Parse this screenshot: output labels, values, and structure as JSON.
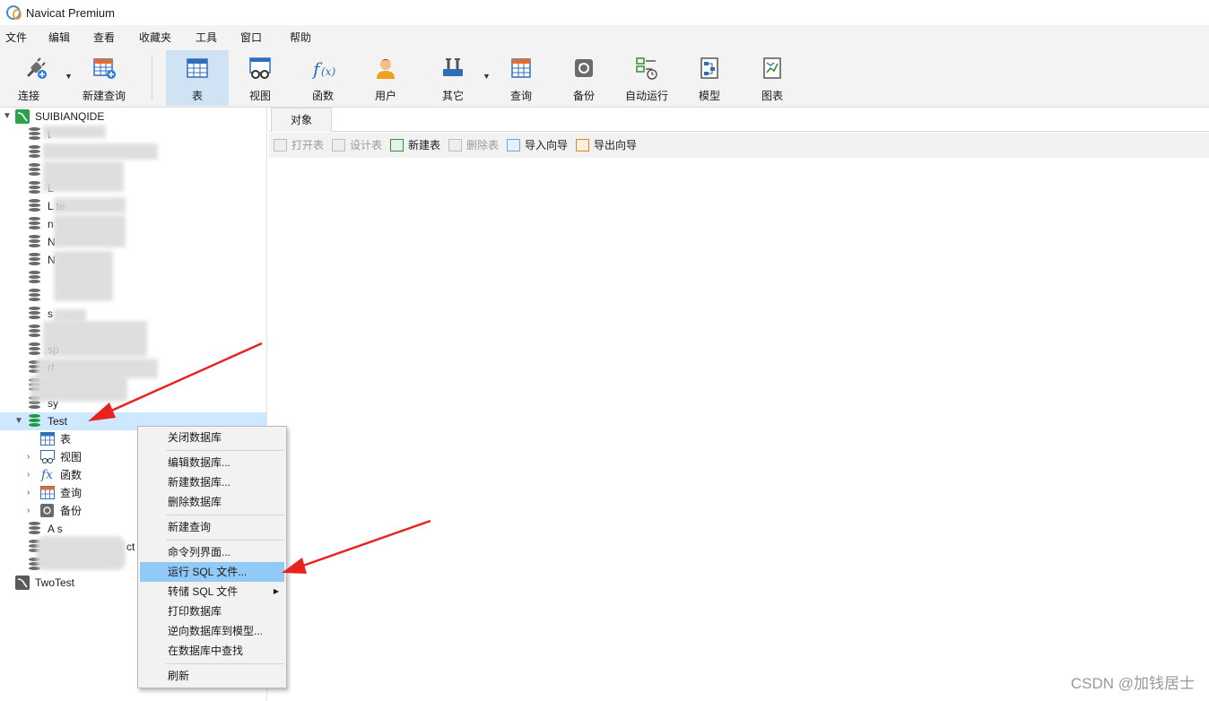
{
  "window": {
    "title": "Navicat Premium"
  },
  "menubar": {
    "items": [
      "文件",
      "编辑",
      "查看",
      "收藏夹",
      "工具",
      "窗口",
      "帮助"
    ]
  },
  "toolbar": {
    "connect": "连接",
    "new_query": "新建查询",
    "table": "表",
    "view": "视图",
    "function": "函数",
    "user": "用户",
    "other": "其它",
    "query": "查询",
    "backup": "备份",
    "automation": "自动运行",
    "model": "模型",
    "chart": "图表"
  },
  "sidebar": {
    "connection": "SUIBIANQIDE",
    "blurred_rows": [
      "t",
      "",
      "",
      "L",
      "L    te",
      "n",
      "N",
      "N",
      "",
      "",
      "s",
      "",
      "sp",
      "rf",
      "",
      "sy"
    ],
    "test_db": "Test",
    "children": [
      "表",
      "视图",
      "函数",
      "查询",
      "备份"
    ],
    "after_rows": [
      "A   s",
      "ct",
      ""
    ],
    "second_connection": "TwoTest"
  },
  "content": {
    "tab": "对象",
    "obj_toolbar": {
      "open_table": "打开表",
      "design_table": "设计表",
      "new_table": "新建表",
      "delete_table": "删除表",
      "import_wizard": "导入向导",
      "export_wizard": "导出向导"
    }
  },
  "context_menu": {
    "close_db": "关闭数据库",
    "edit_db": "编辑数据库...",
    "new_db": "新建数据库...",
    "delete_db": "删除数据库",
    "new_query": "新建查询",
    "console": "命令列界面...",
    "run_sql": "运行 SQL 文件...",
    "dump_sql": "转储 SQL 文件",
    "print_db": "打印数据库",
    "reverse_model": "逆向数据库到模型...",
    "find_in_db": "在数据库中查找",
    "refresh": "刷新"
  },
  "watermark": "CSDN @加钱居士",
  "colors": {
    "accent_arrow": "#e8231f",
    "selection": "#cde8ff",
    "menu_highlight": "#91c9f7"
  }
}
